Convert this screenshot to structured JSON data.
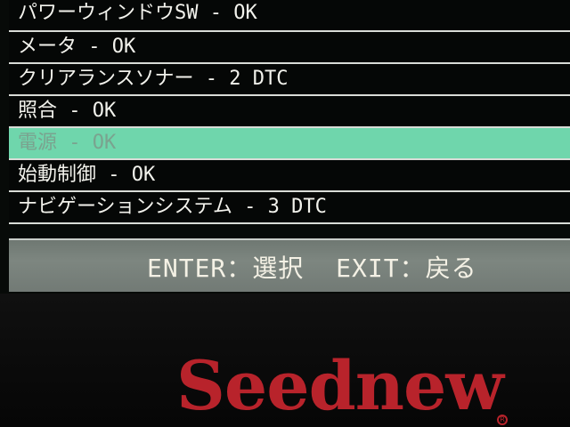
{
  "menu": {
    "items": [
      {
        "label": "パワーウィンドウSW - OK",
        "state": "boxed"
      },
      {
        "label": "メータ - OK",
        "state": "normal"
      },
      {
        "label": "クリアランスソナー - 2 DTC",
        "state": "normal"
      },
      {
        "label": "照合 - OK",
        "state": "normal"
      },
      {
        "label": "電源 - OK",
        "state": "selected"
      },
      {
        "label": "始動制御 - OK",
        "state": "normal"
      },
      {
        "label": "ナビゲーションシステム - 3 DTC",
        "state": "normal"
      }
    ]
  },
  "footer": {
    "enter_label": "ENTER：選択",
    "exit_label": "EXIT：戻る"
  },
  "device": {
    "brand": "Seednew",
    "registered_mark": "R"
  },
  "colors": {
    "highlight_green": "#6fd6ac",
    "box_red": "#d5202b",
    "brand_red": "#b8232b"
  }
}
